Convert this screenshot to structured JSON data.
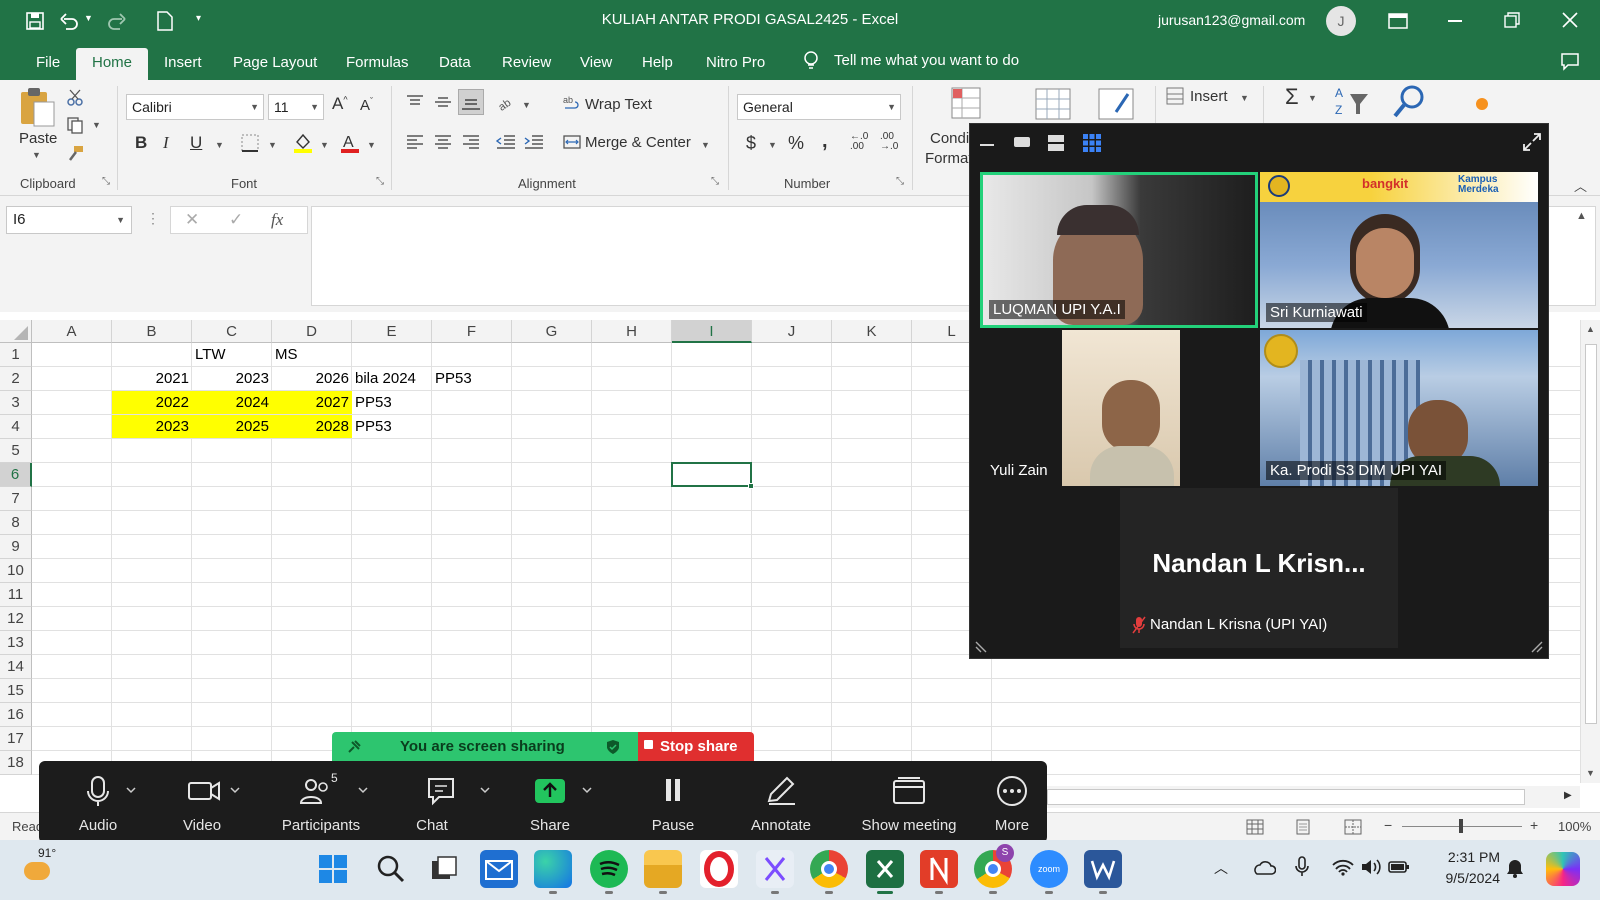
{
  "window": {
    "title": "KULIAH ANTAR PRODI GASAL2425  -  Excel",
    "account_email": "jurusan123@gmail.com",
    "avatar_initial": "J"
  },
  "menu": {
    "tabs": [
      "File",
      "Home",
      "Insert",
      "Page Layout",
      "Formulas",
      "Data",
      "Review",
      "View",
      "Help",
      "Nitro Pro"
    ],
    "tell_me": "Tell me what you want to do"
  },
  "ribbon": {
    "clipboard": {
      "label": "Clipboard",
      "paste": "Paste"
    },
    "font": {
      "label": "Font",
      "family": "Calibri",
      "size": "11",
      "bold": "B",
      "italic": "I",
      "underline": "U"
    },
    "alignment": {
      "label": "Alignment",
      "wrap_text": "Wrap Text",
      "merge_center": "Merge & Center"
    },
    "number": {
      "label": "Number",
      "format": "General",
      "currency": "$",
      "percent": "%",
      "comma": ","
    },
    "styles": {
      "cond_format_1": "Condi",
      "cond_format_2": "Format"
    },
    "cells": {
      "insert": "Insert"
    },
    "accent": "#217346"
  },
  "formula_bar": {
    "name_box": "I6",
    "fx": "fx",
    "value": ""
  },
  "sheet": {
    "columns": [
      "A",
      "B",
      "C",
      "D",
      "E",
      "F",
      "G",
      "H",
      "I",
      "J",
      "K",
      "L"
    ],
    "rows": [
      "1",
      "2",
      "3",
      "4",
      "5",
      "6",
      "7",
      "8",
      "9",
      "10",
      "11",
      "12",
      "13",
      "14",
      "15",
      "16",
      "17",
      "18"
    ],
    "cells": {
      "C1": "LTW",
      "D1": "MS",
      "B2": "2021",
      "C2": "2023",
      "D2": "2026",
      "E2": "bila 2024",
      "F2": "PP53",
      "B3": "2022",
      "C3": "2024",
      "D3": "2027",
      "E3": "PP53",
      "B4": "2023",
      "C4": "2025",
      "D4": "2028",
      "E4": "PP53"
    },
    "highlight_color": "#ffff00",
    "selected_cell": "I6"
  },
  "zoom_meeting": {
    "participants": [
      {
        "name": "LUQMAN UPI Y.A.I",
        "active_speaker": true
      },
      {
        "name": "Sri Kurniawati",
        "banner_text": "bangkit",
        "banner_text2": "Kampus Merdeka"
      },
      {
        "name": "Yuli Zain"
      },
      {
        "name": "Ka. Prodi S3 DIM UPI YAI"
      }
    ],
    "no_video": {
      "big_name": "Nandan  L  Krisn...",
      "name": "Nandan L Krisna (UPI YAI)",
      "muted": true
    },
    "sharing_banner": {
      "text": "You are screen sharing",
      "stop": "Stop share"
    },
    "toolbar": {
      "audio": "Audio",
      "video": "Video",
      "participants": "Participants",
      "participant_count": "5",
      "chat": "Chat",
      "share": "Share",
      "pause": "Pause",
      "annotate": "Annotate",
      "show_meeting": "Show meeting",
      "more": "More"
    }
  },
  "status": {
    "ready": "Read",
    "zoom_level": "100%"
  },
  "taskbar": {
    "weather": "91°",
    "time": "2:31 PM",
    "date": "9/5/2024",
    "chrome_badge": "S",
    "zoom_label": "zoom"
  }
}
